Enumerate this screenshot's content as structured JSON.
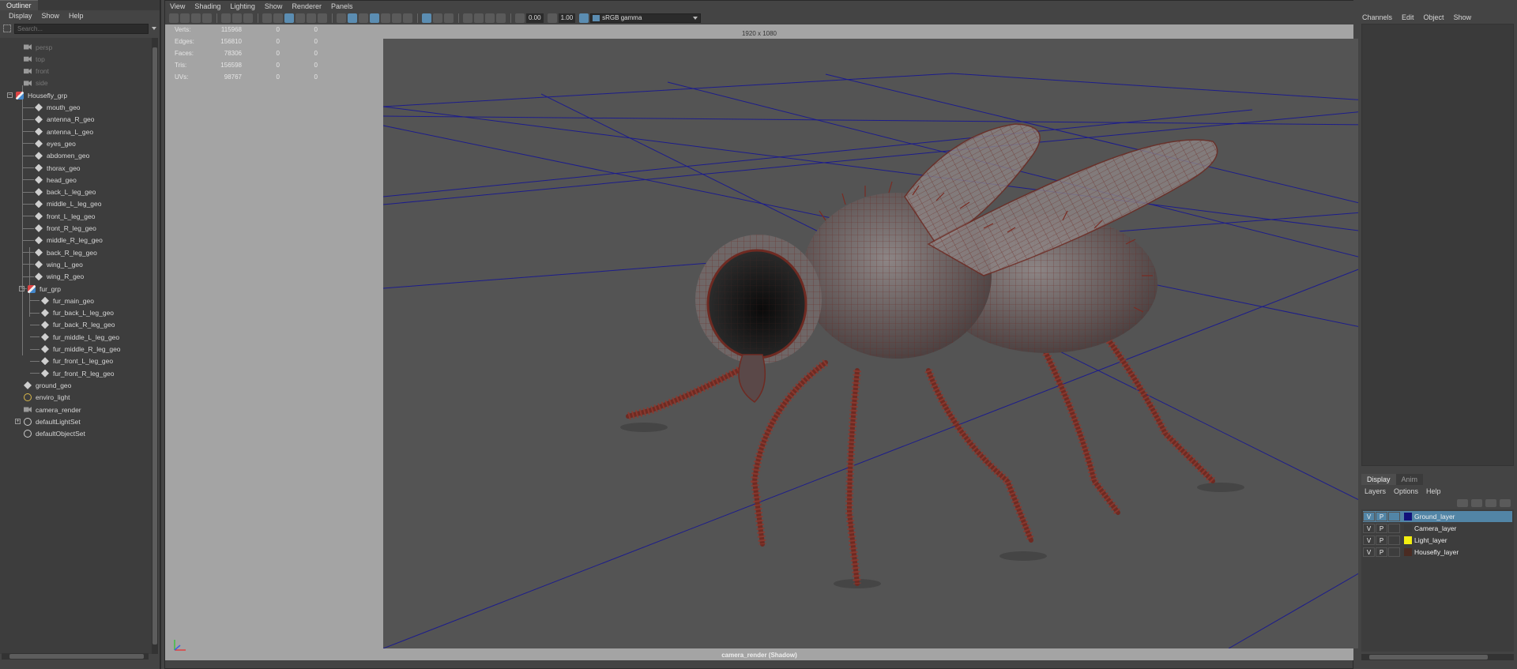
{
  "outliner": {
    "tab": "Outliner",
    "menu": [
      "Display",
      "Show",
      "Help"
    ],
    "search_placeholder": "Search...",
    "items": [
      {
        "label": "persp",
        "icon": "camera-icon",
        "dim": true
      },
      {
        "label": "top",
        "icon": "camera-icon",
        "dim": true
      },
      {
        "label": "front",
        "icon": "camera-icon",
        "dim": true
      },
      {
        "label": "side",
        "icon": "camera-icon",
        "dim": true
      },
      {
        "label": "Housefly_grp",
        "icon": "group-icon"
      },
      {
        "label": "mouth_geo",
        "icon": "mesh-icon"
      },
      {
        "label": "antenna_R_geo",
        "icon": "mesh-icon"
      },
      {
        "label": "antenna_L_geo",
        "icon": "mesh-icon"
      },
      {
        "label": "eyes_geo",
        "icon": "mesh-icon"
      },
      {
        "label": "abdomen_geo",
        "icon": "mesh-icon"
      },
      {
        "label": "thorax_geo",
        "icon": "mesh-icon"
      },
      {
        "label": "head_geo",
        "icon": "mesh-icon"
      },
      {
        "label": "back_L_leg_geo",
        "icon": "mesh-icon"
      },
      {
        "label": "middle_L_leg_geo",
        "icon": "mesh-icon"
      },
      {
        "label": "front_L_leg_geo",
        "icon": "mesh-icon"
      },
      {
        "label": "front_R_leg_geo",
        "icon": "mesh-icon"
      },
      {
        "label": "middle_R_leg_geo",
        "icon": "mesh-icon"
      },
      {
        "label": "back_R_leg_geo",
        "icon": "mesh-icon"
      },
      {
        "label": "wing_L_geo",
        "icon": "mesh-icon"
      },
      {
        "label": "wing_R_geo",
        "icon": "mesh-icon"
      },
      {
        "label": "fur_grp",
        "icon": "group-icon"
      },
      {
        "label": "fur_main_geo",
        "icon": "mesh-icon"
      },
      {
        "label": "fur_back_L_leg_geo",
        "icon": "mesh-icon"
      },
      {
        "label": "fur_back_R_leg_geo",
        "icon": "mesh-icon"
      },
      {
        "label": "fur_middle_L_leg_geo",
        "icon": "mesh-icon"
      },
      {
        "label": "fur_middle_R_leg_geo",
        "icon": "mesh-icon"
      },
      {
        "label": "fur_front_L_leg_geo",
        "icon": "mesh-icon"
      },
      {
        "label": "fur_front_R_leg_geo",
        "icon": "mesh-icon"
      },
      {
        "label": "ground_geo",
        "icon": "mesh-icon"
      },
      {
        "label": "enviro_light",
        "icon": "light-icon"
      },
      {
        "label": "camera_render",
        "icon": "camera-icon"
      },
      {
        "label": "defaultLightSet",
        "icon": "set-icon"
      },
      {
        "label": "defaultObjectSet",
        "icon": "set-icon"
      }
    ]
  },
  "viewport": {
    "menu": [
      "View",
      "Shading",
      "Lighting",
      "Show",
      "Renderer",
      "Panels"
    ],
    "toolbar": {
      "value_a": "0.00",
      "value_b": "1.00",
      "colorspace": "sRGB gamma"
    },
    "resolution": "1920 x 1080",
    "camera_label": "camera_render (Shadow)",
    "hud": [
      {
        "key": "Verts:",
        "v1": "115968",
        "v2": "0",
        "v3": "0"
      },
      {
        "key": "Edges:",
        "v1": "156810",
        "v2": "0",
        "v3": "0"
      },
      {
        "key": "Faces:",
        "v1": "78306",
        "v2": "0",
        "v3": "0"
      },
      {
        "key": "Tris:",
        "v1": "156598",
        "v2": "0",
        "v3": "0"
      },
      {
        "key": "UVs:",
        "v1": "98767",
        "v2": "0",
        "v3": "0"
      }
    ]
  },
  "channel_box": {
    "menu": [
      "Channels",
      "Edit",
      "Object",
      "Show"
    ]
  },
  "layer_editor": {
    "tabs": [
      "Display",
      "Anim"
    ],
    "menu": [
      "Layers",
      "Options",
      "Help"
    ],
    "layers": [
      {
        "v": "V",
        "p": "P",
        "name": "Ground_layer",
        "color": "#12127a",
        "selected": true
      },
      {
        "v": "V",
        "p": "P",
        "name": "Camera_layer",
        "color": "#3a3a3a",
        "selected": false
      },
      {
        "v": "V",
        "p": "P",
        "name": "Light_layer",
        "color": "#f3ef10",
        "selected": false
      },
      {
        "v": "V",
        "p": "P",
        "name": "Housefly_layer",
        "color": "#4a2b22",
        "selected": false
      }
    ]
  },
  "colors": {
    "ui_bg": "#444444",
    "selection": "#5285a6",
    "grid": "#1c1c8c",
    "wire": "#7a2b22"
  }
}
